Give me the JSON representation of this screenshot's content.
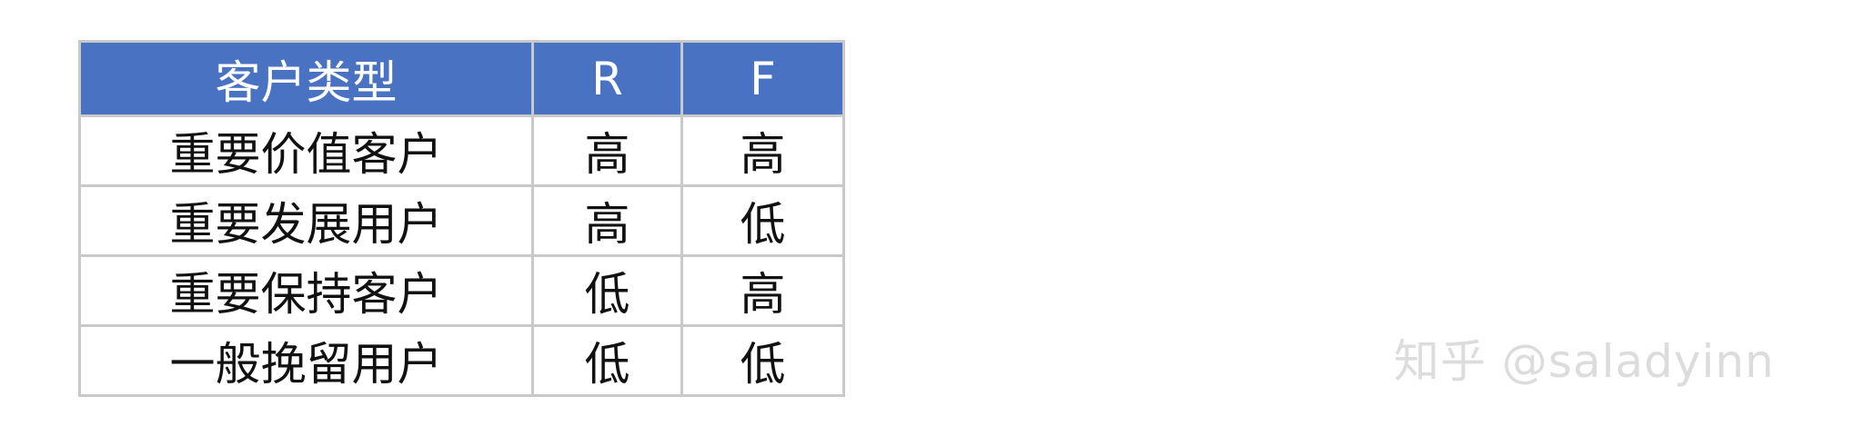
{
  "table": {
    "headers": [
      "客户类型",
      "R",
      "F"
    ],
    "rows": [
      [
        "重要价值客户",
        "高",
        "高"
      ],
      [
        "重要发展用户",
        "高",
        "低"
      ],
      [
        "重要保持客户",
        "低",
        "高"
      ],
      [
        "一般挽留用户",
        "低",
        "低"
      ]
    ]
  },
  "watermark": "知乎 @saladyinn",
  "colors": {
    "header_background": "#4a72c2",
    "header_text": "#ffffff",
    "grid_lines": "#c9c9c9",
    "watermark": "#dcdcdc"
  }
}
